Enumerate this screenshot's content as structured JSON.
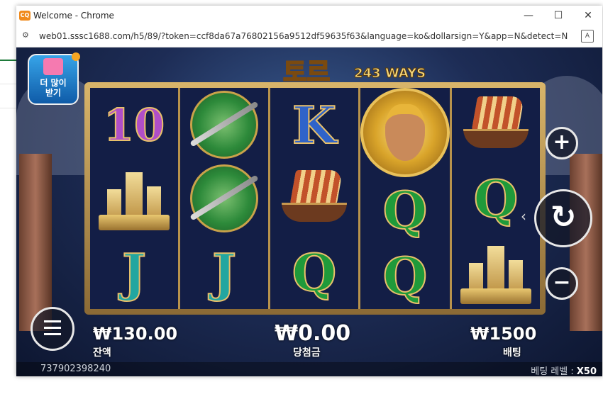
{
  "window": {
    "title": "Welcome - Chrome",
    "app_icon": "CQ"
  },
  "window_controls": {
    "minimize": "—",
    "maximize": "☐",
    "close": "✕"
  },
  "address": {
    "url": "web01.sssc1688.com/h5/89/?token=ccf8da67a76802156a9512df59635f63&language=ko&dollarsign=Y&app=N&detect=N"
  },
  "game": {
    "logo": "토르",
    "ways": "243 WAYS",
    "promo": {
      "line1": "더 많이",
      "line2": "받기"
    },
    "reels": [
      [
        "10",
        "castle",
        "J"
      ],
      [
        "shield",
        "shield",
        "J"
      ],
      [
        "K",
        "ship",
        "Q"
      ],
      [
        "warrior",
        "Q",
        "Q"
      ],
      [
        "ship",
        "Q",
        "castle"
      ]
    ],
    "balance": {
      "value": "₩130.00",
      "label": "잔액"
    },
    "win": {
      "value": "₩0.00",
      "label": "당첨금"
    },
    "bet": {
      "value": "₩1500",
      "label": "배팅"
    },
    "ticket_id": "737902398240",
    "bet_level_label": "베팅 레벨 :",
    "bet_level_value": "X50",
    "buttons": {
      "plus": "+",
      "minus": "−",
      "spin": "↻",
      "arrow": "‹"
    }
  }
}
